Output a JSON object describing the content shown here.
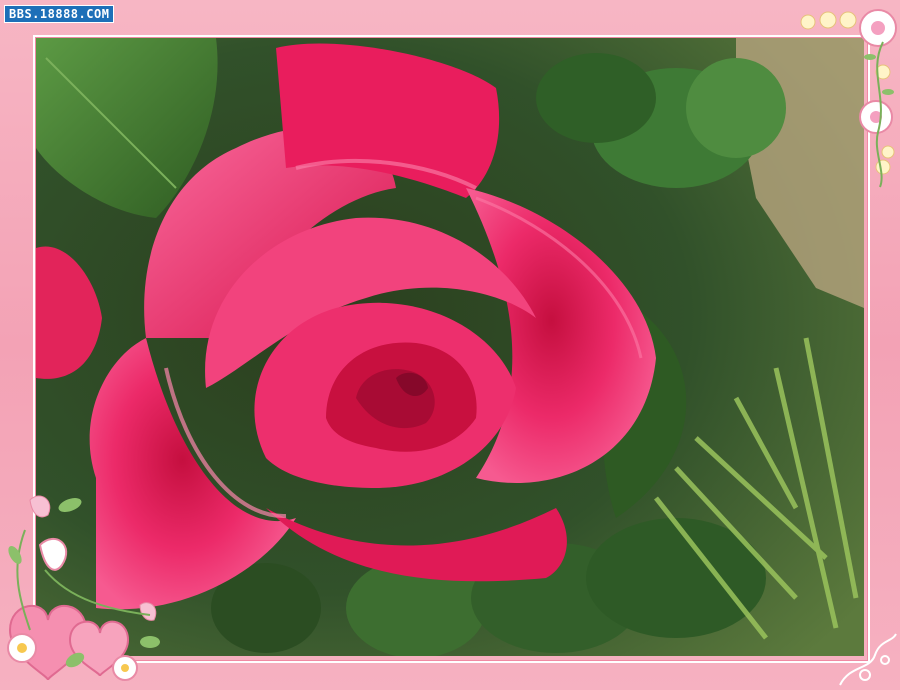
{
  "watermark": {
    "text": "BBS.18888.COM"
  },
  "photo": {
    "subject": "pink-rose-photo"
  },
  "colors": {
    "frame": "#f4a9b9",
    "rose": "#e8185c",
    "leaf": "#3f7a2c"
  }
}
